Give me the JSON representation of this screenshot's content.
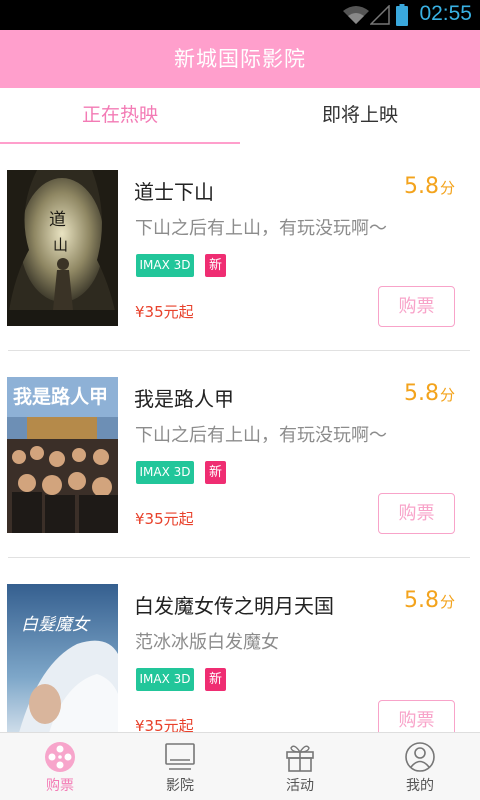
{
  "status_bar": {
    "time": "02:55"
  },
  "header": {
    "title": "新城国际影院"
  },
  "tabs": [
    {
      "label": "正在热映",
      "active": true
    },
    {
      "label": "即将上映",
      "active": false
    }
  ],
  "movies": [
    {
      "title": "道士下山",
      "score": "5.8",
      "score_unit": "分",
      "description": "下山之后有上山，有玩没玩啊～",
      "tag_format": "IMAX 3D",
      "tag_new": "新",
      "price": "¥35元起",
      "buy_label": "购票",
      "poster_text": "道士下山"
    },
    {
      "title": "我是路人甲",
      "score": "5.8",
      "score_unit": "分",
      "description": "下山之后有上山，有玩没玩啊～",
      "tag_format": "IMAX 3D",
      "tag_new": "新",
      "price": "¥35元起",
      "buy_label": "购票",
      "poster_text": "我是路人甲"
    },
    {
      "title": "白发魔女传之明月天国",
      "score": "5.8",
      "score_unit": "分",
      "description": "范冰冰版白发魔女",
      "tag_format": "IMAX 3D",
      "tag_new": "新",
      "price": "¥35元起",
      "buy_label": "购票",
      "poster_text": "白发魔女"
    }
  ],
  "bottom_nav": [
    {
      "label": "购票",
      "icon": "film-reel-icon",
      "active": true
    },
    {
      "label": "影院",
      "icon": "screen-icon",
      "active": false
    },
    {
      "label": "活动",
      "icon": "gift-icon",
      "active": false
    },
    {
      "label": "我的",
      "icon": "user-icon",
      "active": false
    }
  ],
  "colors": {
    "brand_pink": "#ff9fcc",
    "active_pink": "#f37bb5",
    "score_orange": "#f3a31c",
    "imax_green": "#22c69a",
    "new_red": "#ef2d72",
    "price_red": "#e8412b"
  }
}
